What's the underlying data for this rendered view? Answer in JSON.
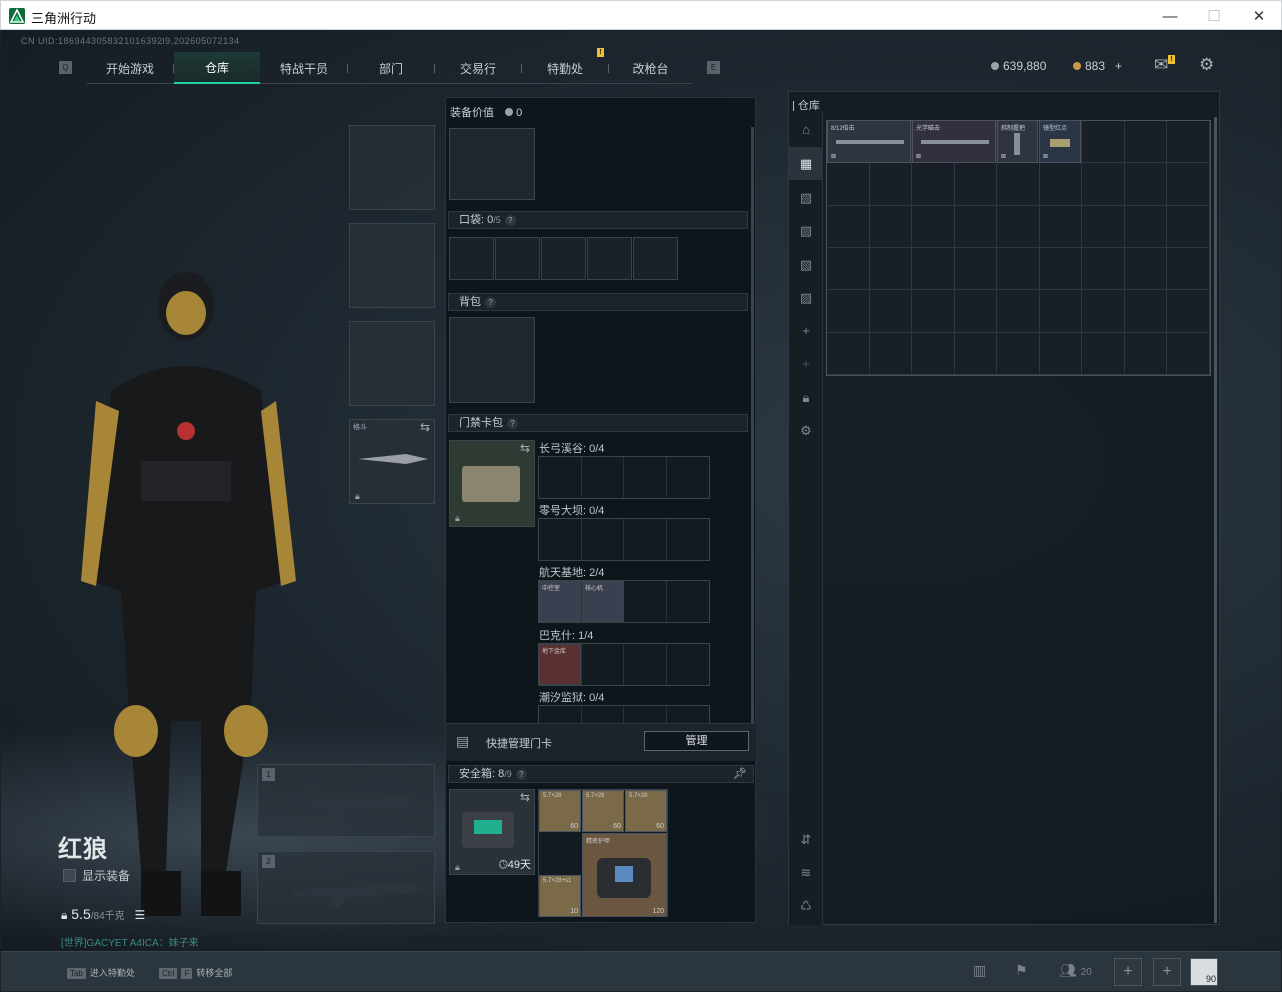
{
  "window": {
    "title": "三角洲行动"
  },
  "uid": "CN UID:1869443058321016392...",
  "uid_full": "CN UID:1869443058321016392l9,202605072134",
  "nav": {
    "tabs": [
      {
        "label": "开始游戏"
      },
      {
        "label": "仓库"
      },
      {
        "label": "特战干员"
      },
      {
        "label": "部门"
      },
      {
        "label": "交易行"
      },
      {
        "label": "特勤处"
      },
      {
        "label": "改枪台"
      }
    ],
    "left_key": "Q",
    "right_key": "E",
    "badge": "!"
  },
  "currency": {
    "silver": "639,880",
    "gold": "883",
    "add": "+"
  },
  "operator": {
    "name": "红狼",
    "show_equipment": "显示装备",
    "weight": "5.5",
    "weight_max": "/84千克",
    "status": "[世界]GACYET A4ICA：妹子来"
  },
  "slots": {
    "melee_label": "格斗",
    "weapon1_num": "1",
    "weapon2_num": "2"
  },
  "equipment": {
    "value_label": "装备价值",
    "value": "0",
    "pockets": {
      "label": "口袋:",
      "count": "0",
      "max": "/5"
    },
    "backpack": {
      "label": "背包"
    },
    "keycard": {
      "label": "门禁卡包"
    },
    "maps": [
      {
        "name": "长弓溪谷: 0/4"
      },
      {
        "name": "零号大坝: 0/4"
      },
      {
        "name": "航天基地: 2/4"
      },
      {
        "name": "巴克什: 1/4"
      },
      {
        "name": "潮汐监狱: 0/4"
      }
    ],
    "card_labels": [
      "中控室",
      "核心机",
      "地下金库"
    ],
    "quick_manage": "快捷管理门卡",
    "manage_btn": "管理",
    "safebox": {
      "label": "安全箱:",
      "count": "8",
      "max": "/9",
      "days": "49天"
    },
    "ammo": [
      {
        "label": "5.7×28",
        "count": "60"
      },
      {
        "label": "5.7×28",
        "count": "60"
      },
      {
        "label": "5.7×28",
        "count": "60"
      },
      {
        "label": "5.7×28+s1",
        "count": "10"
      }
    ],
    "armor": {
      "label": "精密护甲",
      "count": "120"
    }
  },
  "warehouse": {
    "label": "仓库",
    "items": [
      {
        "label": "8/12倍击"
      },
      {
        "label": "光学瞄击"
      },
      {
        "label": "斜制握把"
      },
      {
        "label": "镜型红点"
      }
    ]
  },
  "bottom": {
    "tab_key": "Tab",
    "tab_hint": "进入特勤处",
    "ctrl_key": "Ctrl",
    "f_key": "F",
    "ctrl_hint": "转移全部",
    "friends": "20",
    "plus": "+",
    "avatar_badge": "90"
  }
}
